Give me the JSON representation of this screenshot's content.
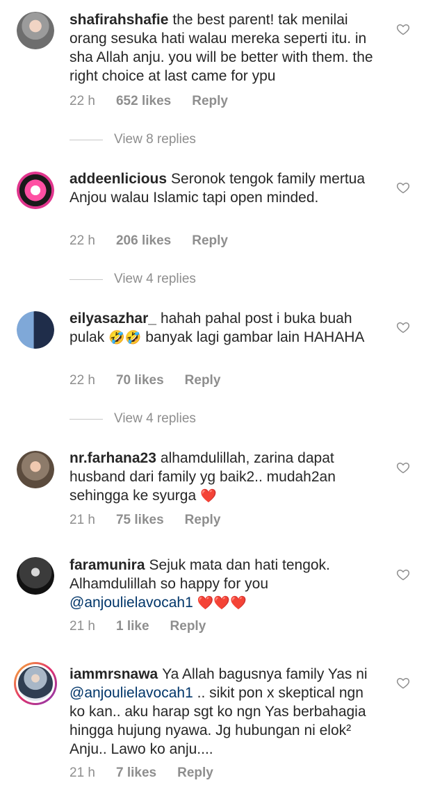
{
  "comments": [
    {
      "username": "shafirahshafie",
      "text": "the best parent! tak menilai orang sesuka hati walau mereka seperti itu. in sha Allah anju. you will be better with them. the right choice at last came for ypu",
      "time": "22 h",
      "likes": "652 likes",
      "reply": "Reply",
      "view_replies": "View 8 replies"
    },
    {
      "username": "addeenlicious",
      "text": "Seronok tengok family mertua Anjou walau Islamic tapi open minded.",
      "time": "22 h",
      "likes": "206 likes",
      "reply": "Reply",
      "view_replies": "View 4 replies"
    },
    {
      "username": "eilyasazhar_",
      "text_before": "hahah pahal post i buka buah pulak",
      "emoji": "🤣🤣",
      "text_after": "banyak lagi gambar lain HAHAHA",
      "time": "22 h",
      "likes": "70 likes",
      "reply": "Reply",
      "view_replies": "View 4 replies"
    },
    {
      "username": "nr.farhana23",
      "text": "alhamdulillah, zarina dapat husband dari family yg baik2.. mudah2an sehingga ke syurga",
      "emoji": "❤️",
      "time": "21 h",
      "likes": "75 likes",
      "reply": "Reply"
    },
    {
      "username": "faramunira",
      "text": "Sejuk mata dan hati tengok. Alhamdulillah so happy for you",
      "mention": "@anjoulielavocah1",
      "emoji": "❤️❤️❤️",
      "time": "21 h",
      "likes": "1 like",
      "reply": "Reply"
    },
    {
      "username": "iammrsnawa",
      "text_before": "Ya Allah bagusnya family Yas ni",
      "mention": "@anjoulielavocah1",
      "text_after": ".. sikit pon x skeptical ngn ko kan.. aku harap sgt ko ngn Yas berbahagia hingga hujung nyawa. Jg hubungan ni elok² Anju.. Lawo ko anju....",
      "time": "21 h",
      "likes": "7 likes",
      "reply": "Reply"
    }
  ],
  "colors": {
    "text": "#262626",
    "secondary": "#8e8e8e",
    "mention": "#003569"
  }
}
